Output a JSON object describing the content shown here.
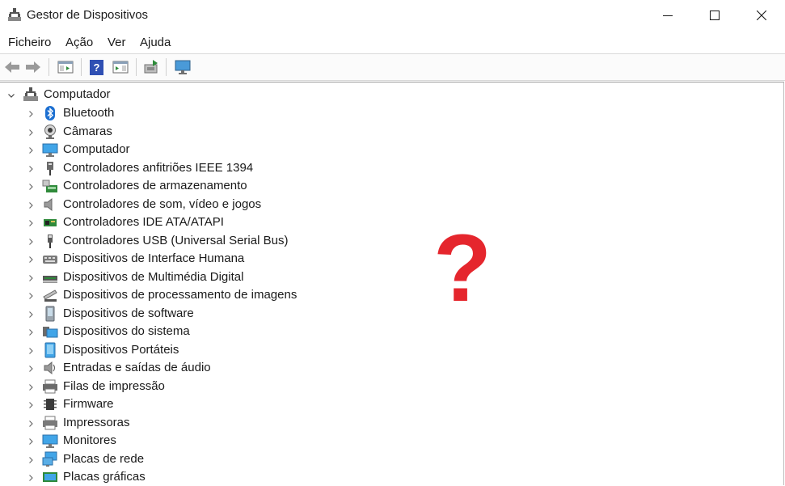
{
  "window": {
    "title": "Gestor de Dispositivos"
  },
  "menu": [
    "Ficheiro",
    "Ação",
    "Ver",
    "Ajuda"
  ],
  "toolbar_icons": [
    "back-arrow-icon",
    "forward-arrow-icon",
    "properties-pane-icon",
    "help-icon",
    "show-hide-icon",
    "scan-hardware-icon",
    "monitor-icon"
  ],
  "tree": {
    "root": "Computador",
    "items": [
      {
        "label": "Bluetooth",
        "icon": "bluetooth-icon"
      },
      {
        "label": "Câmaras",
        "icon": "camera-icon"
      },
      {
        "label": "Computador",
        "icon": "computer-icon"
      },
      {
        "label": "Controladores anfitriões IEEE 1394",
        "icon": "ieee1394-icon"
      },
      {
        "label": "Controladores de armazenamento",
        "icon": "storage-controller-icon"
      },
      {
        "label": "Controladores de som, vídeo e jogos",
        "icon": "speaker-icon"
      },
      {
        "label": "Controladores IDE ATA/ATAPI",
        "icon": "ide-controller-icon"
      },
      {
        "label": "Controladores USB (Universal Serial Bus)",
        "icon": "usb-icon"
      },
      {
        "label": "Dispositivos de Interface Humana",
        "icon": "hid-icon"
      },
      {
        "label": "Dispositivos de Multimédia Digital",
        "icon": "multimedia-icon"
      },
      {
        "label": "Dispositivos de processamento de imagens",
        "icon": "scanner-icon"
      },
      {
        "label": "Dispositivos de software",
        "icon": "software-device-icon"
      },
      {
        "label": "Dispositivos do sistema",
        "icon": "system-device-icon"
      },
      {
        "label": "Dispositivos Portáteis",
        "icon": "portable-device-icon"
      },
      {
        "label": "Entradas e saídas de áudio",
        "icon": "audio-io-icon"
      },
      {
        "label": "Filas de impressão",
        "icon": "print-queue-icon"
      },
      {
        "label": "Firmware",
        "icon": "firmware-chip-icon"
      },
      {
        "label": "Impressoras",
        "icon": "printer-icon"
      },
      {
        "label": "Monitores",
        "icon": "monitor-icon"
      },
      {
        "label": "Placas de rede",
        "icon": "network-adapter-icon"
      },
      {
        "label": "Placas gráficas",
        "icon": "display-adapter-icon"
      }
    ]
  },
  "overlay": {
    "text": "?",
    "color": "#e5262d"
  }
}
